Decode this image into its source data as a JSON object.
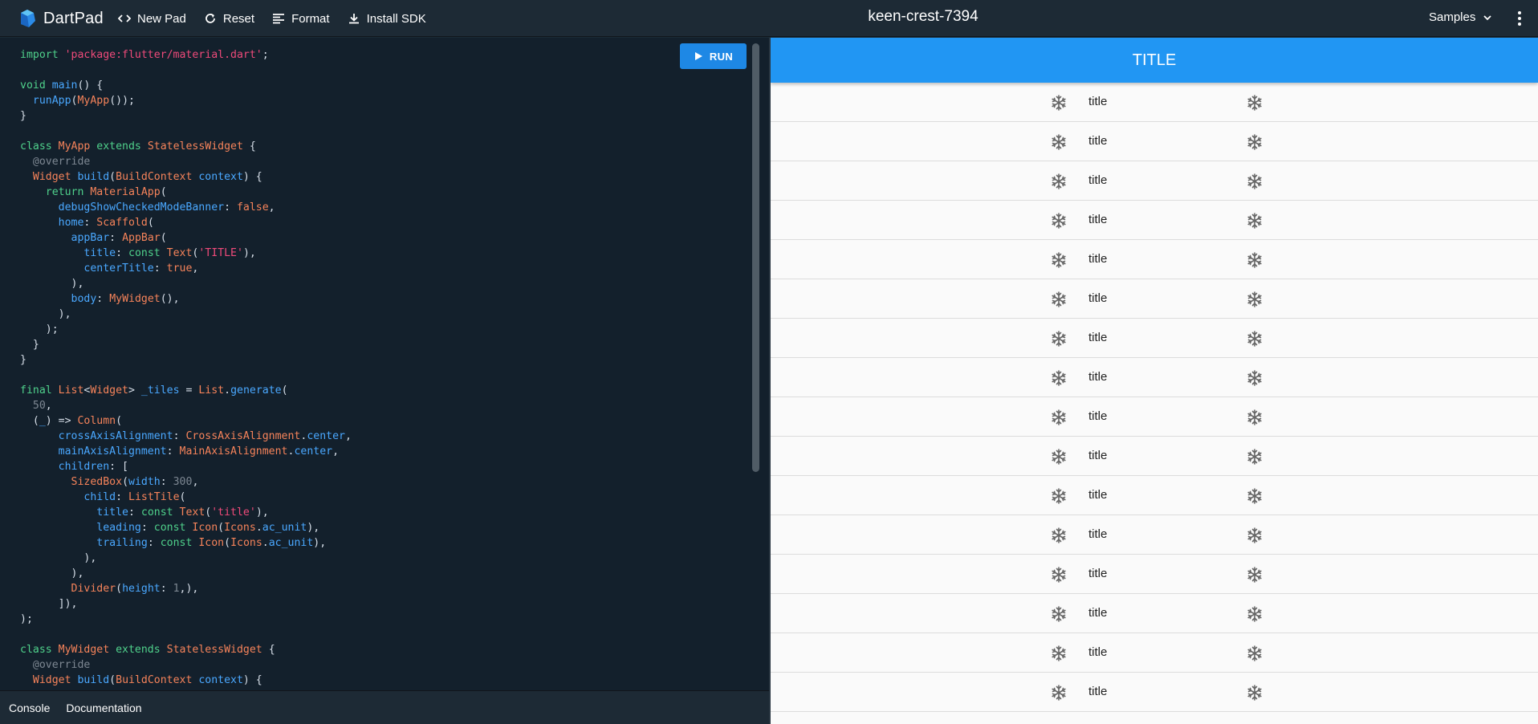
{
  "brand": {
    "name": "DartPad"
  },
  "toolbar": {
    "new_pad": "New Pad",
    "reset": "Reset",
    "format": "Format",
    "install_sdk": "Install SDK"
  },
  "pad_title": "keen-crest-7394",
  "samples_label": "Samples",
  "run_label": "RUN",
  "bottom_tabs": [
    "Console",
    "Documentation"
  ],
  "preview": {
    "appbar_title": "TITLE",
    "tile_title": "title",
    "tile_count": 16,
    "tile_icon": "ac-unit-icon"
  },
  "colors": {
    "accent": "#2196f3",
    "run_button": "#1e88e5",
    "editor_bg": "#13202c",
    "topbar_bg": "#1d2a35"
  },
  "code_lines": [
    [
      [
        "import ",
        "kw"
      ],
      [
        "'package:flutter/material.dart'",
        "st"
      ],
      [
        ";",
        ""
      ]
    ],
    [],
    [
      [
        "void ",
        "kw"
      ],
      [
        "main",
        "fn"
      ],
      [
        "() {",
        ""
      ]
    ],
    [
      [
        "  ",
        ""
      ],
      [
        "runApp",
        "fn"
      ],
      [
        "(",
        ""
      ],
      [
        "MyApp",
        "ty"
      ],
      [
        "());",
        ""
      ]
    ],
    [
      [
        "}",
        ""
      ]
    ],
    [],
    [
      [
        "class ",
        "kw"
      ],
      [
        "MyApp ",
        "ty"
      ],
      [
        "extends ",
        "kw"
      ],
      [
        "StatelessWidget ",
        "ty"
      ],
      [
        "{",
        ""
      ]
    ],
    [
      [
        "  ",
        ""
      ],
      [
        "@override",
        "an"
      ]
    ],
    [
      [
        "  ",
        ""
      ],
      [
        "Widget ",
        "ty"
      ],
      [
        "build",
        "fn"
      ],
      [
        "(",
        ""
      ],
      [
        "BuildContext ",
        "ty"
      ],
      [
        "context",
        "pr"
      ],
      [
        ") {",
        ""
      ]
    ],
    [
      [
        "    ",
        ""
      ],
      [
        "return ",
        "kw"
      ],
      [
        "MaterialApp",
        "ty"
      ],
      [
        "(",
        ""
      ]
    ],
    [
      [
        "      ",
        ""
      ],
      [
        "debugShowCheckedModeBanner",
        "pr"
      ],
      [
        ": ",
        ""
      ],
      [
        "false",
        "bl"
      ],
      [
        ",",
        ""
      ]
    ],
    [
      [
        "      ",
        ""
      ],
      [
        "home",
        "pr"
      ],
      [
        ": ",
        ""
      ],
      [
        "Scaffold",
        "ty"
      ],
      [
        "(",
        ""
      ]
    ],
    [
      [
        "        ",
        ""
      ],
      [
        "appBar",
        "pr"
      ],
      [
        ": ",
        ""
      ],
      [
        "AppBar",
        "ty"
      ],
      [
        "(",
        ""
      ]
    ],
    [
      [
        "          ",
        ""
      ],
      [
        "title",
        "pr"
      ],
      [
        ": ",
        ""
      ],
      [
        "const ",
        "kw"
      ],
      [
        "Text",
        "ty"
      ],
      [
        "(",
        ""
      ],
      [
        "'TITLE'",
        "st"
      ],
      [
        "),",
        ""
      ]
    ],
    [
      [
        "          ",
        ""
      ],
      [
        "centerTitle",
        "pr"
      ],
      [
        ": ",
        ""
      ],
      [
        "true",
        "bl"
      ],
      [
        ",",
        ""
      ]
    ],
    [
      [
        "        ),",
        ""
      ]
    ],
    [
      [
        "        ",
        ""
      ],
      [
        "body",
        "pr"
      ],
      [
        ": ",
        ""
      ],
      [
        "MyWidget",
        "ty"
      ],
      [
        "(),",
        ""
      ]
    ],
    [
      [
        "      ),",
        ""
      ]
    ],
    [
      [
        "    );",
        ""
      ]
    ],
    [
      [
        "  }",
        ""
      ]
    ],
    [
      [
        "}",
        ""
      ]
    ],
    [],
    [
      [
        "final ",
        "kw"
      ],
      [
        "List",
        "ty"
      ],
      [
        "<",
        ""
      ],
      [
        "Widget",
        "ty"
      ],
      [
        "> ",
        ""
      ],
      [
        "_tiles ",
        "pr"
      ],
      [
        "= ",
        ""
      ],
      [
        "List",
        "ty"
      ],
      [
        ".",
        ""
      ],
      [
        "generate",
        "fn"
      ],
      [
        "(",
        ""
      ]
    ],
    [
      [
        "  ",
        ""
      ],
      [
        "50",
        "nu"
      ],
      [
        ",",
        ""
      ]
    ],
    [
      [
        "  (",
        ""
      ],
      [
        "_",
        "pr"
      ],
      [
        ") => ",
        ""
      ],
      [
        "Column",
        "ty"
      ],
      [
        "(",
        ""
      ]
    ],
    [
      [
        "      ",
        ""
      ],
      [
        "crossAxisAlignment",
        "pr"
      ],
      [
        ": ",
        ""
      ],
      [
        "CrossAxisAlignment",
        "ty"
      ],
      [
        ".",
        ""
      ],
      [
        "center",
        "pr"
      ],
      [
        ",",
        ""
      ]
    ],
    [
      [
        "      ",
        ""
      ],
      [
        "mainAxisAlignment",
        "pr"
      ],
      [
        ": ",
        ""
      ],
      [
        "MainAxisAlignment",
        "ty"
      ],
      [
        ".",
        ""
      ],
      [
        "center",
        "pr"
      ],
      [
        ",",
        ""
      ]
    ],
    [
      [
        "      ",
        ""
      ],
      [
        "children",
        "pr"
      ],
      [
        ": [",
        ""
      ]
    ],
    [
      [
        "        ",
        ""
      ],
      [
        "SizedBox",
        "ty"
      ],
      [
        "(",
        ""
      ],
      [
        "width",
        "pr"
      ],
      [
        ": ",
        ""
      ],
      [
        "300",
        "nu"
      ],
      [
        ",",
        ""
      ]
    ],
    [
      [
        "          ",
        ""
      ],
      [
        "child",
        "pr"
      ],
      [
        ": ",
        ""
      ],
      [
        "ListTile",
        "ty"
      ],
      [
        "(",
        ""
      ]
    ],
    [
      [
        "            ",
        ""
      ],
      [
        "title",
        "pr"
      ],
      [
        ": ",
        ""
      ],
      [
        "const ",
        "kw"
      ],
      [
        "Text",
        "ty"
      ],
      [
        "(",
        ""
      ],
      [
        "'title'",
        "st"
      ],
      [
        "),",
        ""
      ]
    ],
    [
      [
        "            ",
        ""
      ],
      [
        "leading",
        "pr"
      ],
      [
        ": ",
        ""
      ],
      [
        "const ",
        "kw"
      ],
      [
        "Icon",
        "ty"
      ],
      [
        "(",
        ""
      ],
      [
        "Icons",
        "ty"
      ],
      [
        ".",
        ""
      ],
      [
        "ac_unit",
        "pr"
      ],
      [
        "),",
        ""
      ]
    ],
    [
      [
        "            ",
        ""
      ],
      [
        "trailing",
        "pr"
      ],
      [
        ": ",
        ""
      ],
      [
        "const ",
        "kw"
      ],
      [
        "Icon",
        "ty"
      ],
      [
        "(",
        ""
      ],
      [
        "Icons",
        "ty"
      ],
      [
        ".",
        ""
      ],
      [
        "ac_unit",
        "pr"
      ],
      [
        "),",
        ""
      ]
    ],
    [
      [
        "          ),",
        ""
      ]
    ],
    [
      [
        "        ),",
        ""
      ]
    ],
    [
      [
        "        ",
        ""
      ],
      [
        "Divider",
        "ty"
      ],
      [
        "(",
        ""
      ],
      [
        "height",
        "pr"
      ],
      [
        ": ",
        ""
      ],
      [
        "1",
        "nu"
      ],
      [
        ",),",
        ""
      ]
    ],
    [
      [
        "      ]),",
        ""
      ]
    ],
    [
      [
        ");",
        ""
      ]
    ],
    [],
    [
      [
        "class ",
        "kw"
      ],
      [
        "MyWidget ",
        "ty"
      ],
      [
        "extends ",
        "kw"
      ],
      [
        "StatelessWidget ",
        "ty"
      ],
      [
        "{",
        ""
      ]
    ],
    [
      [
        "  ",
        ""
      ],
      [
        "@override",
        "an"
      ]
    ],
    [
      [
        "  ",
        ""
      ],
      [
        "Widget ",
        "ty"
      ],
      [
        "build",
        "fn"
      ],
      [
        "(",
        ""
      ],
      [
        "BuildContext ",
        "ty"
      ],
      [
        "context",
        "pr"
      ],
      [
        ") {",
        ""
      ]
    ]
  ]
}
